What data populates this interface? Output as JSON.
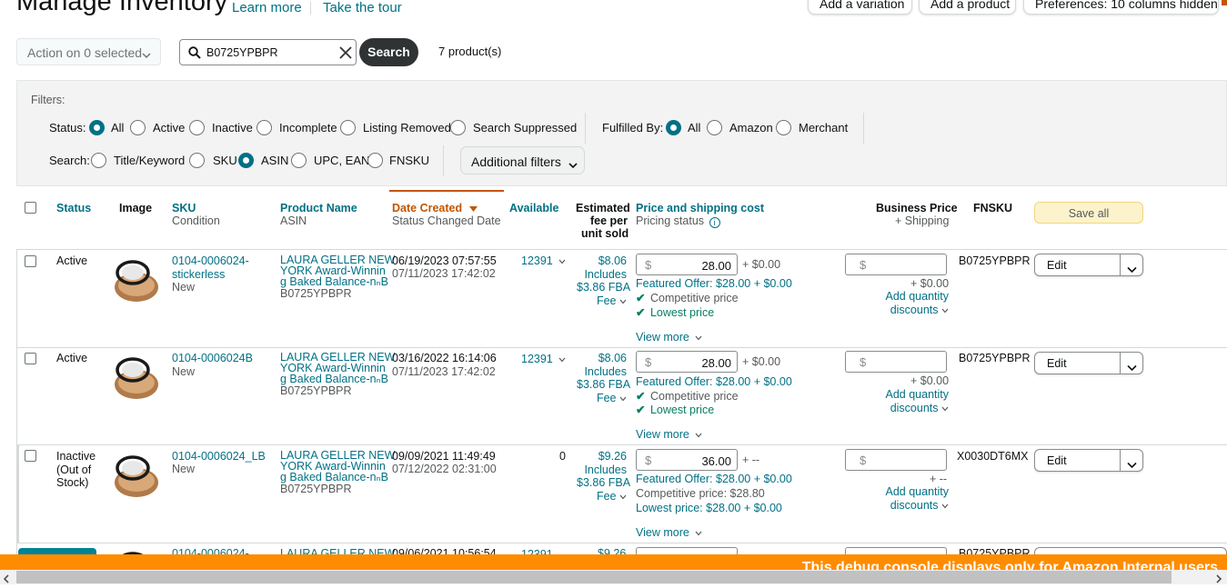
{
  "header": {
    "title": "Manage Inventory",
    "learn_more": "Learn more",
    "take_tour": "Take the tour",
    "add_variation": "Add a variation",
    "add_product": "Add a product",
    "preferences": "Preferences: 10 columns hidden"
  },
  "toolbar": {
    "action_label": "Action on 0 selected",
    "search_value": "B0725YPBPR",
    "search_button": "Search",
    "result_count": "7 product(s)"
  },
  "filters": {
    "heading": "Filters:",
    "status_label": "Status:",
    "status_options": [
      "All",
      "Active",
      "Inactive",
      "Incomplete",
      "Listing Removed",
      "Search Suppressed"
    ],
    "status_selected": "All",
    "fulfilled_label": "Fulfilled By:",
    "fulfilled_options": [
      "All",
      "Amazon",
      "Merchant"
    ],
    "fulfilled_selected": "All",
    "search_label": "Search:",
    "search_options": [
      "Title/Keyword",
      "SKU",
      "ASIN",
      "UPC, EAN",
      "FNSKU"
    ],
    "search_selected": "ASIN",
    "additional_filters": "Additional filters"
  },
  "table": {
    "headers": {
      "status": "Status",
      "image": "Image",
      "sku": "SKU",
      "sku_sub": "Condition",
      "product_name": "Product Name",
      "product_name_sub": "ASIN",
      "date_created": "Date Created",
      "date_created_sub": "Status Changed Date",
      "available": "Available",
      "est_fee_1": "Estimated",
      "est_fee_2": "fee per",
      "est_fee_3": "unit sold",
      "price": "Price and shipping cost",
      "price_sub": "Pricing status",
      "business_price": "Business Price",
      "business_price_sub": "+ Shipping",
      "fnsku": "FNSKU",
      "save_all": "Save all"
    },
    "rows": [
      {
        "status_lines": [
          "Active"
        ],
        "sku_lines": [
          "0104-0006024-",
          "stickerless"
        ],
        "condition": "New",
        "name_lines": [
          "LAURA GELLER NEW",
          "YORK Award-Winnin",
          "g Baked Balance-nₙB"
        ],
        "asin": "B0725YPBPR",
        "date_created": "06/19/2023 07:57:55",
        "status_changed": "07/11/2023 17:42:02",
        "available": "12391",
        "fee_amount": "$8.06",
        "fee_includes": "Includes",
        "fee_fba": "$3.86 FBA",
        "fee_label": "Fee",
        "currency": "$",
        "price": "28.00",
        "shipping": "+ $0.00",
        "featured_offer": "Featured Offer: $28.00 + $0.00",
        "pricing_lines": [
          "Competitive price",
          "Lowest price"
        ],
        "pricing_checked": true,
        "view_more": "View more",
        "biz_shipping": "+ $0.00",
        "add_qty_1": "Add quantity",
        "add_qty_2": "discounts",
        "fnsku": "B0725YPBPR",
        "edit": "Edit"
      },
      {
        "status_lines": [
          "Active"
        ],
        "sku_lines": [
          "0104-0006024B"
        ],
        "condition": "New",
        "name_lines": [
          "LAURA GELLER NEW",
          "YORK Award-Winnin",
          "g Baked Balance-nₙB"
        ],
        "asin": "B0725YPBPR",
        "date_created": "03/16/2022 16:14:06",
        "status_changed": "07/11/2023 17:42:02",
        "available": "12391",
        "fee_amount": "$8.06",
        "fee_includes": "Includes",
        "fee_fba": "$3.86 FBA",
        "fee_label": "Fee",
        "currency": "$",
        "price": "28.00",
        "shipping": "+ $0.00",
        "featured_offer": "Featured Offer: $28.00 + $0.00",
        "pricing_lines": [
          "Competitive price",
          "Lowest price"
        ],
        "pricing_checked": true,
        "view_more": "View more",
        "biz_shipping": "+ $0.00",
        "add_qty_1": "Add quantity",
        "add_qty_2": "discounts",
        "fnsku": "B0725YPBPR",
        "edit": "Edit"
      },
      {
        "status_lines": [
          "Inactive",
          "(Out of",
          "Stock)"
        ],
        "sku_lines": [
          "0104-0006024_LB"
        ],
        "condition": "New",
        "name_lines": [
          "LAURA GELLER NEW",
          "YORK Award-Winnin",
          "g Baked Balance-nₙB"
        ],
        "asin": "B0725YPBPR",
        "date_created": "09/09/2021 11:49:49",
        "status_changed": "07/12/2022 02:31:00",
        "available": "0",
        "fee_amount": "$9.26",
        "fee_includes": "Includes",
        "fee_fba": "$3.86 FBA",
        "fee_label": "Fee",
        "currency": "$",
        "price": "36.00",
        "shipping": "+ --",
        "featured_offer": "Featured Offer: $28.00 + $0.00",
        "pricing_lines": [
          "Competitive price: $28.80",
          "Lowest price: $28.00 + $0.00"
        ],
        "pricing_checked": false,
        "view_more": "View more",
        "biz_shipping": "+ --",
        "add_qty_1": "Add quantity",
        "add_qty_2": "discounts",
        "fnsku": "X0030DT6MX",
        "edit": "Edit"
      },
      {
        "sku_partial": "0104-0006024-",
        "name_partial": "LAURA GELLER NEW",
        "date_partial": "09/06/2021 10:56:54",
        "available_partial": "12391",
        "fee_partial": "$9.26",
        "fnsku_partial": "B0725YPBPR"
      }
    ]
  },
  "debug_banner": "This debug console displays only for Amazon Internal users",
  "colors": {
    "link": "#007185",
    "accent_orange": "#c45500",
    "debug_orange": "#ff8c00",
    "check_green": "#067d62"
  }
}
